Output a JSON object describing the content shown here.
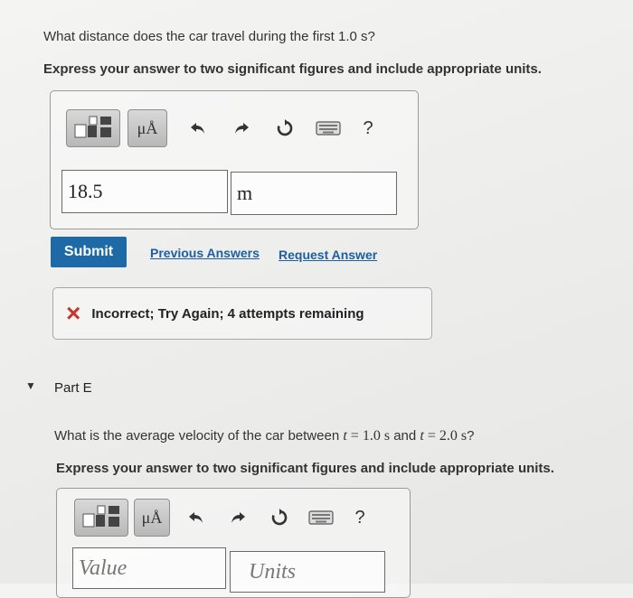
{
  "part_d": {
    "question": "What distance does the car travel during the first 1.0 s?",
    "instruction": "Express your answer to two significant figures and include appropriate units.",
    "toolbar": {
      "units_label": "μÅ",
      "help_label": "?"
    },
    "value": "18.5",
    "units": "m",
    "submit_label": "Submit",
    "previous_answers_label": "Previous Answers",
    "request_answer_label": "Request Answer",
    "feedback": {
      "icon": "×",
      "text": "Incorrect; Try Again; 4 attempts remaining",
      "color": "#c0392b"
    }
  },
  "part_e": {
    "title": "Part E",
    "question_prefix": "What is the average velocity of the car between ",
    "var1": "t",
    "eq1": " = 1.0 s",
    "and": " and ",
    "var2": "t",
    "eq2": " = 2.0 s",
    "question_suffix": "?",
    "instruction": "Express your answer to two significant figures and include appropriate units.",
    "toolbar": {
      "units_label": "μÅ",
      "help_label": "?"
    },
    "value_placeholder": "Value",
    "units_placeholder": "Units"
  },
  "colors": {
    "submit_bg": "#1d6aa6",
    "link": "#1d5fa0"
  }
}
